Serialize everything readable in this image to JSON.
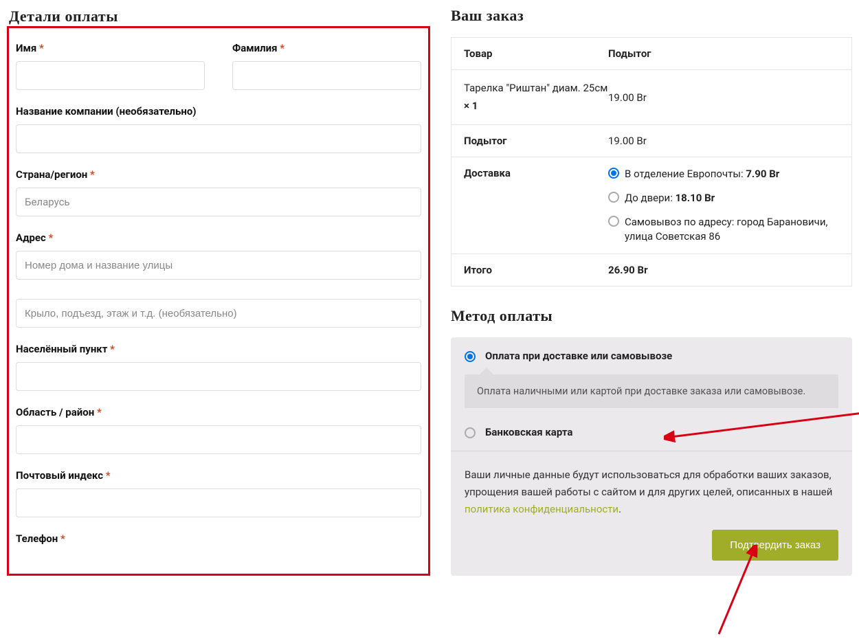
{
  "billing": {
    "title": "Детали оплаты",
    "first_name_label": "Имя",
    "last_name_label": "Фамилия",
    "company_label": "Название компании (необязательно)",
    "country_label": "Страна/регион",
    "country_value": "Беларусь",
    "address_label": "Адрес",
    "address1_placeholder": "Номер дома и название улицы",
    "address2_placeholder": "Крыло, подъезд, этаж и т.д. (необязательно)",
    "city_label": "Населённый пункт",
    "state_label": "Область / район",
    "postcode_label": "Почтовый индекс",
    "phone_label": "Телефон",
    "required_mark": "*"
  },
  "order": {
    "title": "Ваш заказ",
    "head_product": "Товар",
    "head_subtotal": "Подытог",
    "item_name": "Тарелка \"Риштан\" диам. 25см ",
    "item_qty": " × 1",
    "item_subtotal": "19.00 Br",
    "subtotal_label": "Подытог",
    "subtotal_value": "19.00 Br",
    "shipping_label": "Доставка",
    "shipping": [
      {
        "selected": true,
        "label_pre": "В отделение Европочты: ",
        "price": "7.90 Br"
      },
      {
        "selected": false,
        "label_pre": "До двери: ",
        "price": "18.10 Br"
      },
      {
        "selected": false,
        "label_pre": "Самовывоз по адресу: город Барановичи, улица Советская 86",
        "price": ""
      }
    ],
    "total_label": "Итого",
    "total_value": "26.90 Br"
  },
  "payment": {
    "title": "Метод оплаты",
    "options": [
      {
        "selected": true,
        "label": "Оплата при доставке или самовывозе",
        "desc": "Оплата наличными или картой при доставке заказа или самовывозе."
      },
      {
        "selected": false,
        "label": "Банковская карта",
        "desc": ""
      }
    ],
    "privacy_text_1": "Ваши личные данные будут использоваться для обработки ваших заказов, упрощения вашей работы с сайтом и для других целей, описанных в нашей ",
    "privacy_link": "политика конфиденциальности",
    "privacy_text_2": ".",
    "submit_label": "Подтвердить заказ"
  }
}
